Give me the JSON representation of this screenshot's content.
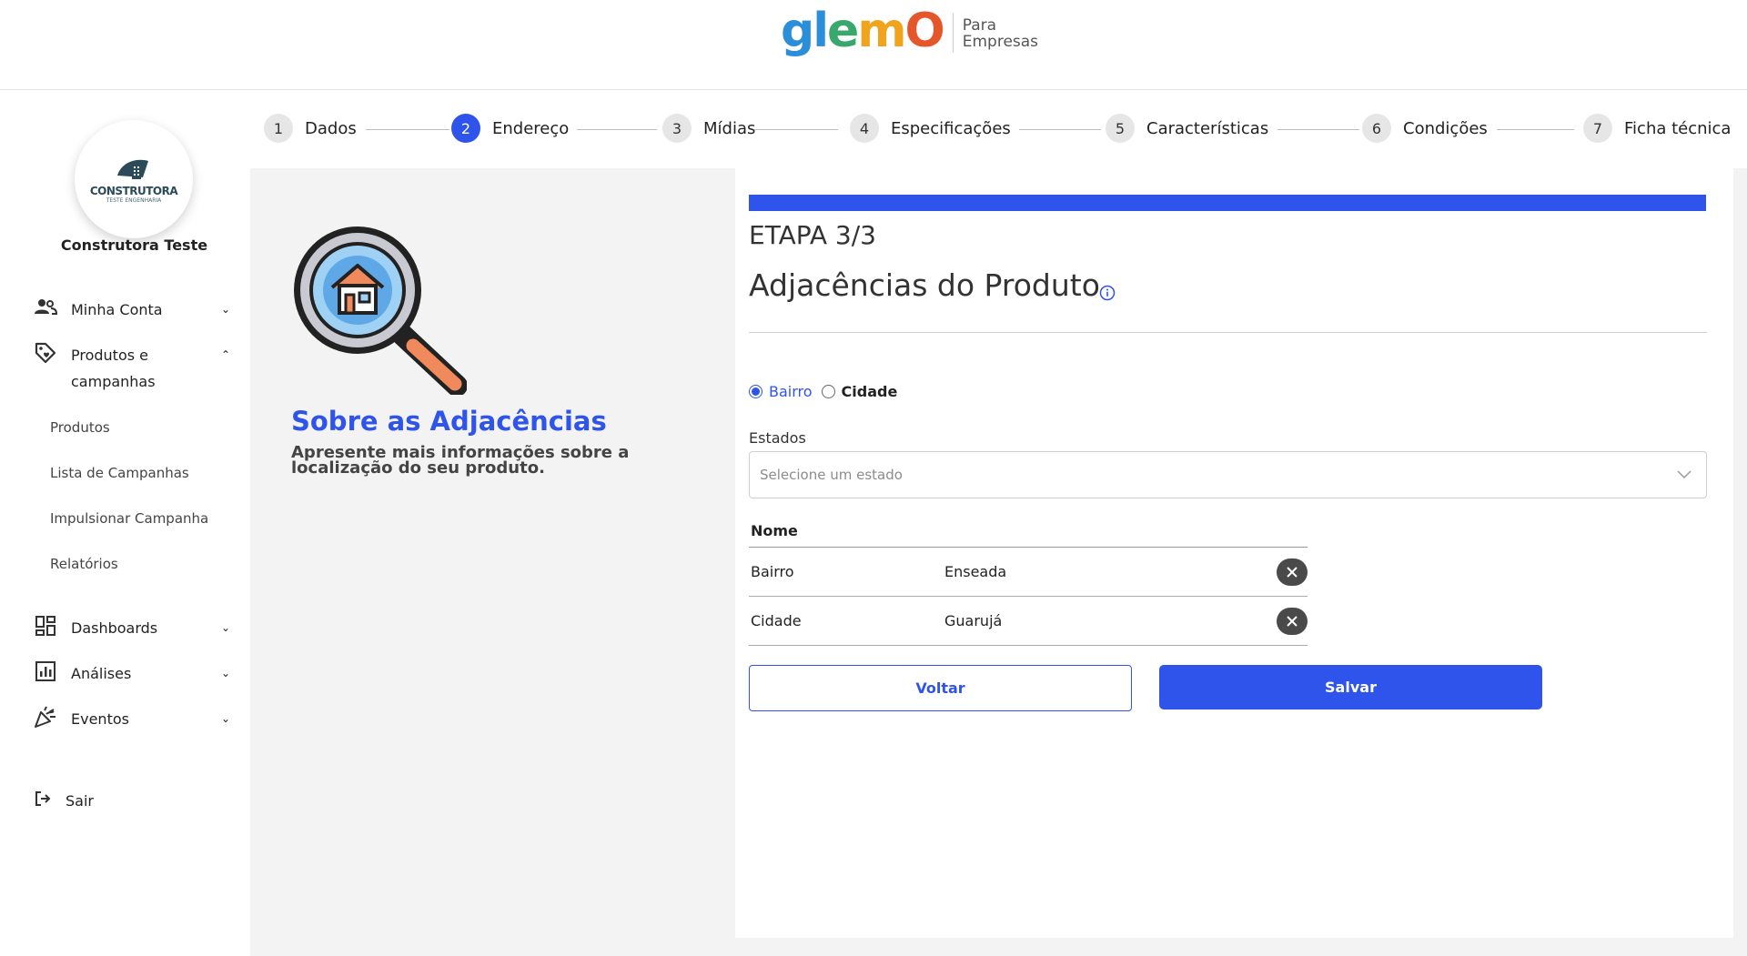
{
  "header": {
    "logo_word": [
      "gl",
      "e",
      "m",
      "O"
    ],
    "logo_sub_1": "Para",
    "logo_sub_2": "Empresas"
  },
  "sidebar": {
    "avatar_text": "CONSTRUTORA",
    "avatar_sub": "TESTE ENGENHARIA",
    "company": "Construtora Teste",
    "items": [
      {
        "label": "Minha Conta",
        "icon": "users-icon"
      },
      {
        "label": "Produtos e campanhas",
        "icon": "tag-icon"
      },
      {
        "label": "Dashboards",
        "icon": "dashboard-icon"
      },
      {
        "label": "Análises",
        "icon": "chart-icon"
      },
      {
        "label": "Eventos",
        "icon": "party-icon"
      }
    ],
    "sub_items": [
      "Produtos",
      "Lista de Campanhas",
      "Impulsionar Campanha",
      "Relatórios"
    ],
    "logout": "Sair"
  },
  "stepper": [
    {
      "num": "1",
      "label": "Dados",
      "active": false
    },
    {
      "num": "2",
      "label": "Endereço",
      "active": true
    },
    {
      "num": "3",
      "label": "Mídias",
      "active": false
    },
    {
      "num": "4",
      "label": "Especificações",
      "active": false
    },
    {
      "num": "5",
      "label": "Características",
      "active": false
    },
    {
      "num": "6",
      "label": "Condições",
      "active": false
    },
    {
      "num": "7",
      "label": "Ficha técnica",
      "active": false
    }
  ],
  "info": {
    "title": "Sobre as Adjacências",
    "description": "Apresente mais informações sobre a localização do seu produto."
  },
  "form": {
    "progress": 1.0,
    "etapa": "ETAPA 3/3",
    "title": "Adjacências do Produto",
    "radio_options": [
      "Bairro",
      "Cidade"
    ],
    "radio_selected": "Bairro",
    "estados_label": "Estados",
    "estados_placeholder": "Selecione um estado",
    "table_header": "Nome",
    "rows": [
      {
        "type": "Bairro",
        "name": "Enseada"
      },
      {
        "type": "Cidade",
        "name": "Guarujá"
      }
    ],
    "back_label": "Voltar",
    "save_label": "Salvar"
  },
  "colors": {
    "accent": "#2f54eb",
    "background": "#f3f3f4"
  }
}
